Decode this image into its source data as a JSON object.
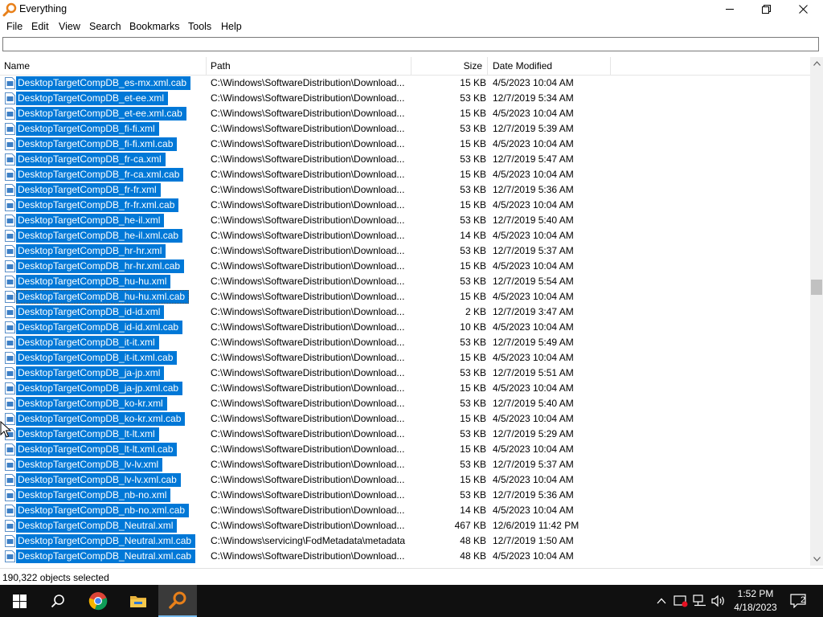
{
  "window": {
    "title": "Everything"
  },
  "menu": [
    "File",
    "Edit",
    "View",
    "Search",
    "Bookmarks",
    "Tools",
    "Help"
  ],
  "search": {
    "value": ""
  },
  "columns": {
    "name": "Name",
    "path": "Path",
    "size": "Size",
    "date": "Date Modified"
  },
  "rows": [
    {
      "name": "DesktopTargetCompDB_es-mx.xml.cab",
      "path": "C:\\Windows\\SoftwareDistribution\\Download...",
      "size": "15 KB",
      "date": "4/5/2023 10:04 AM"
    },
    {
      "name": "DesktopTargetCompDB_et-ee.xml",
      "path": "C:\\Windows\\SoftwareDistribution\\Download...",
      "size": "53 KB",
      "date": "12/7/2019 5:34 AM"
    },
    {
      "name": "DesktopTargetCompDB_et-ee.xml.cab",
      "path": "C:\\Windows\\SoftwareDistribution\\Download...",
      "size": "15 KB",
      "date": "4/5/2023 10:04 AM"
    },
    {
      "name": "DesktopTargetCompDB_fi-fi.xml",
      "path": "C:\\Windows\\SoftwareDistribution\\Download...",
      "size": "53 KB",
      "date": "12/7/2019 5:39 AM"
    },
    {
      "name": "DesktopTargetCompDB_fi-fi.xml.cab",
      "path": "C:\\Windows\\SoftwareDistribution\\Download...",
      "size": "15 KB",
      "date": "4/5/2023 10:04 AM"
    },
    {
      "name": "DesktopTargetCompDB_fr-ca.xml",
      "path": "C:\\Windows\\SoftwareDistribution\\Download...",
      "size": "53 KB",
      "date": "12/7/2019 5:47 AM"
    },
    {
      "name": "DesktopTargetCompDB_fr-ca.xml.cab",
      "path": "C:\\Windows\\SoftwareDistribution\\Download...",
      "size": "15 KB",
      "date": "4/5/2023 10:04 AM"
    },
    {
      "name": "DesktopTargetCompDB_fr-fr.xml",
      "path": "C:\\Windows\\SoftwareDistribution\\Download...",
      "size": "53 KB",
      "date": "12/7/2019 5:36 AM"
    },
    {
      "name": "DesktopTargetCompDB_fr-fr.xml.cab",
      "path": "C:\\Windows\\SoftwareDistribution\\Download...",
      "size": "15 KB",
      "date": "4/5/2023 10:04 AM"
    },
    {
      "name": "DesktopTargetCompDB_he-il.xml",
      "path": "C:\\Windows\\SoftwareDistribution\\Download...",
      "size": "53 KB",
      "date": "12/7/2019 5:40 AM"
    },
    {
      "name": "DesktopTargetCompDB_he-il.xml.cab",
      "path": "C:\\Windows\\SoftwareDistribution\\Download...",
      "size": "14 KB",
      "date": "4/5/2023 10:04 AM"
    },
    {
      "name": "DesktopTargetCompDB_hr-hr.xml",
      "path": "C:\\Windows\\SoftwareDistribution\\Download...",
      "size": "53 KB",
      "date": "12/7/2019 5:37 AM"
    },
    {
      "name": "DesktopTargetCompDB_hr-hr.xml.cab",
      "path": "C:\\Windows\\SoftwareDistribution\\Download...",
      "size": "15 KB",
      "date": "4/5/2023 10:04 AM"
    },
    {
      "name": "DesktopTargetCompDB_hu-hu.xml",
      "path": "C:\\Windows\\SoftwareDistribution\\Download...",
      "size": "53 KB",
      "date": "12/7/2019 5:54 AM"
    },
    {
      "name": "DesktopTargetCompDB_hu-hu.xml.cab",
      "path": "C:\\Windows\\SoftwareDistribution\\Download...",
      "size": "15 KB",
      "date": "4/5/2023 10:04 AM",
      "focused": true
    },
    {
      "name": "DesktopTargetCompDB_id-id.xml",
      "path": "C:\\Windows\\SoftwareDistribution\\Download...",
      "size": "2 KB",
      "date": "12/7/2019 3:47 AM"
    },
    {
      "name": "DesktopTargetCompDB_id-id.xml.cab",
      "path": "C:\\Windows\\SoftwareDistribution\\Download...",
      "size": "10 KB",
      "date": "4/5/2023 10:04 AM"
    },
    {
      "name": "DesktopTargetCompDB_it-it.xml",
      "path": "C:\\Windows\\SoftwareDistribution\\Download...",
      "size": "53 KB",
      "date": "12/7/2019 5:49 AM"
    },
    {
      "name": "DesktopTargetCompDB_it-it.xml.cab",
      "path": "C:\\Windows\\SoftwareDistribution\\Download...",
      "size": "15 KB",
      "date": "4/5/2023 10:04 AM"
    },
    {
      "name": "DesktopTargetCompDB_ja-jp.xml",
      "path": "C:\\Windows\\SoftwareDistribution\\Download...",
      "size": "53 KB",
      "date": "12/7/2019 5:51 AM"
    },
    {
      "name": "DesktopTargetCompDB_ja-jp.xml.cab",
      "path": "C:\\Windows\\SoftwareDistribution\\Download...",
      "size": "15 KB",
      "date": "4/5/2023 10:04 AM"
    },
    {
      "name": "DesktopTargetCompDB_ko-kr.xml",
      "path": "C:\\Windows\\SoftwareDistribution\\Download...",
      "size": "53 KB",
      "date": "12/7/2019 5:40 AM"
    },
    {
      "name": "DesktopTargetCompDB_ko-kr.xml.cab",
      "path": "C:\\Windows\\SoftwareDistribution\\Download...",
      "size": "15 KB",
      "date": "4/5/2023 10:04 AM"
    },
    {
      "name": "DesktopTargetCompDB_lt-lt.xml",
      "path": "C:\\Windows\\SoftwareDistribution\\Download...",
      "size": "53 KB",
      "date": "12/7/2019 5:29 AM"
    },
    {
      "name": "DesktopTargetCompDB_lt-lt.xml.cab",
      "path": "C:\\Windows\\SoftwareDistribution\\Download...",
      "size": "15 KB",
      "date": "4/5/2023 10:04 AM"
    },
    {
      "name": "DesktopTargetCompDB_lv-lv.xml",
      "path": "C:\\Windows\\SoftwareDistribution\\Download...",
      "size": "53 KB",
      "date": "12/7/2019 5:37 AM"
    },
    {
      "name": "DesktopTargetCompDB_lv-lv.xml.cab",
      "path": "C:\\Windows\\SoftwareDistribution\\Download...",
      "size": "15 KB",
      "date": "4/5/2023 10:04 AM"
    },
    {
      "name": "DesktopTargetCompDB_nb-no.xml",
      "path": "C:\\Windows\\SoftwareDistribution\\Download...",
      "size": "53 KB",
      "date": "12/7/2019 5:36 AM"
    },
    {
      "name": "DesktopTargetCompDB_nb-no.xml.cab",
      "path": "C:\\Windows\\SoftwareDistribution\\Download...",
      "size": "14 KB",
      "date": "4/5/2023 10:04 AM"
    },
    {
      "name": "DesktopTargetCompDB_Neutral.xml",
      "path": "C:\\Windows\\SoftwareDistribution\\Download...",
      "size": "467 KB",
      "date": "12/6/2019 11:42 PM"
    },
    {
      "name": "DesktopTargetCompDB_Neutral.xml.cab",
      "path": "C:\\Windows\\servicing\\FodMetadata\\metadata",
      "size": "48 KB",
      "date": "12/7/2019 1:50 AM"
    },
    {
      "name": "DesktopTargetCompDB_Neutral.xml.cab",
      "path": "C:\\Windows\\SoftwareDistribution\\Download...",
      "size": "48 KB",
      "date": "4/5/2023 10:04 AM"
    }
  ],
  "status": {
    "text": "190,322 objects selected"
  },
  "taskbar": {
    "items": [
      "start-icon",
      "search-icon",
      "chrome-icon",
      "file-explorer-icon",
      "everything-icon"
    ],
    "time": "1:52 PM",
    "date": "4/18/2023",
    "notification_count": "2"
  },
  "colors": {
    "selection": "#0078d7",
    "taskbar": "#101010"
  }
}
